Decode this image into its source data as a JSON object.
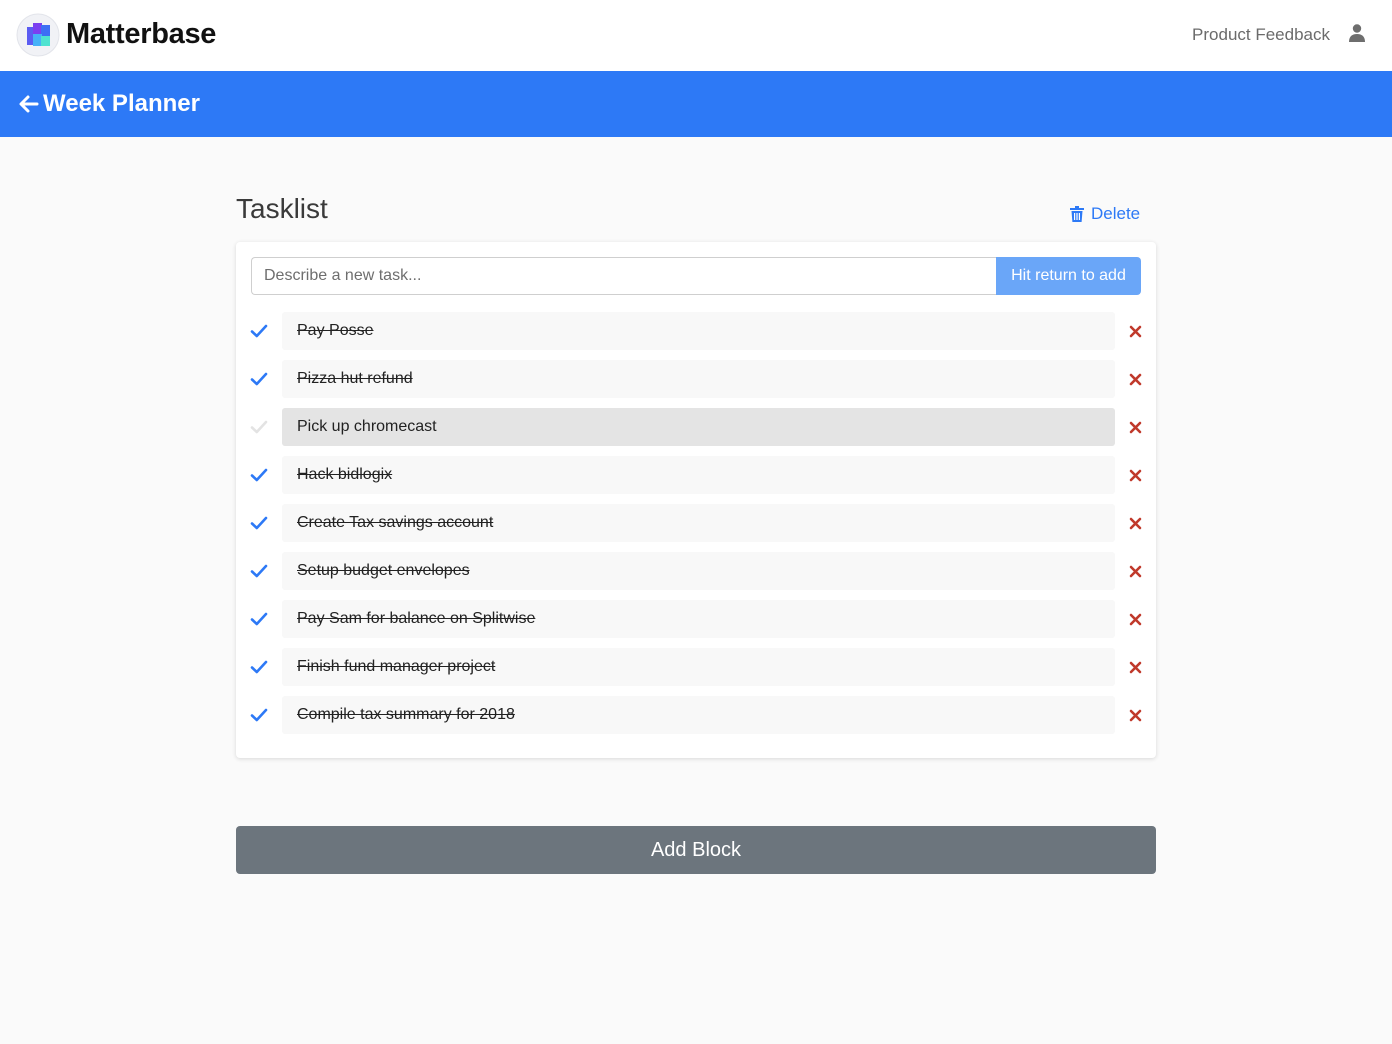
{
  "header": {
    "brand": "Matterbase",
    "feedback_link": "Product Feedback"
  },
  "page": {
    "title": "Week Planner"
  },
  "block": {
    "title": "Tasklist",
    "delete_label": "Delete",
    "new_task_placeholder": "Describe a new task...",
    "add_button_label": "Hit return to add",
    "tasks": [
      {
        "text": "Pay Posse",
        "done": true
      },
      {
        "text": "Pizza hut refund",
        "done": true
      },
      {
        "text": "Pick up chromecast",
        "done": false
      },
      {
        "text": "Hack bidlogix",
        "done": true
      },
      {
        "text": "Create Tax savings account",
        "done": true
      },
      {
        "text": "Setup budget envelopes",
        "done": true
      },
      {
        "text": "Pay Sam for balance on Splitwise",
        "done": true
      },
      {
        "text": "Finish fund manager project",
        "done": true
      },
      {
        "text": "Compile tax summary for 2018",
        "done": true
      }
    ]
  },
  "add_block_label": "Add Block",
  "colors": {
    "accent": "#2d79f6",
    "check_done": "#2d79f6",
    "check_pending": "#e3e3e3",
    "remove": "#c0392b",
    "add_block_bg": "#6c757d"
  }
}
